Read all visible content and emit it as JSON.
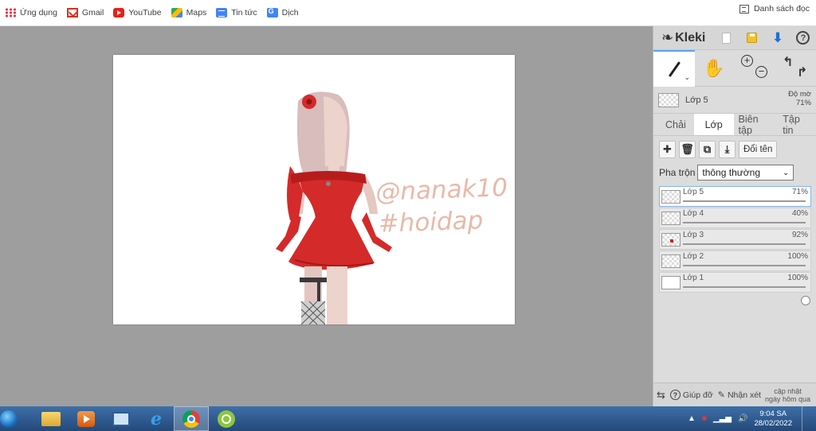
{
  "bookmarks": {
    "items": [
      {
        "label": "Ứng dụng",
        "icon": "apps-icon"
      },
      {
        "label": "Gmail",
        "icon": "gmail-icon"
      },
      {
        "label": "YouTube",
        "icon": "youtube-icon"
      },
      {
        "label": "Maps",
        "icon": "maps-icon"
      },
      {
        "label": "Tin tức",
        "icon": "news-icon"
      },
      {
        "label": "Dịch",
        "icon": "translate-icon"
      }
    ],
    "reading_list": "Danh sách đọc"
  },
  "panel": {
    "logo": "Kleki",
    "active_layer": {
      "name": "Lớp 5",
      "opacity_label": "Độ mờ",
      "opacity_value": "71%"
    },
    "tabs": [
      "Chải",
      "Lớp",
      "Biên tập",
      "Tập tin"
    ],
    "active_tab": "Lớp",
    "rename_label": "Đổi tên",
    "blend": {
      "label": "Pha trộn",
      "value": "thông thường"
    },
    "layers": [
      {
        "name": "Lớp 5",
        "opacity": "71%",
        "value": 0.71,
        "active": true
      },
      {
        "name": "Lớp 4",
        "opacity": "40%",
        "value": 0.4,
        "active": false
      },
      {
        "name": "Lớp 3",
        "opacity": "92%",
        "value": 0.92,
        "active": false
      },
      {
        "name": "Lớp 2",
        "opacity": "100%",
        "value": 1.0,
        "active": false
      },
      {
        "name": "Lớp 1",
        "opacity": "100%",
        "value": 1.0,
        "active": false
      }
    ],
    "bottom": {
      "help": "Giúp đỡ",
      "feedback": "Nhận xét",
      "update_line1": "cập nhật",
      "update_line2": "ngày hôm qua"
    }
  },
  "canvas": {
    "handwriting_line1": "@nanak10",
    "handwriting_line2": "#hoidap"
  },
  "taskbar": {
    "time": "9:04 SA",
    "date": "28/02/2022"
  },
  "colors": {
    "dress": "#d42a2a",
    "handwriting": "#e9b9a8",
    "taskbar": "#2f5d94",
    "panel": "#dcdcdc"
  }
}
